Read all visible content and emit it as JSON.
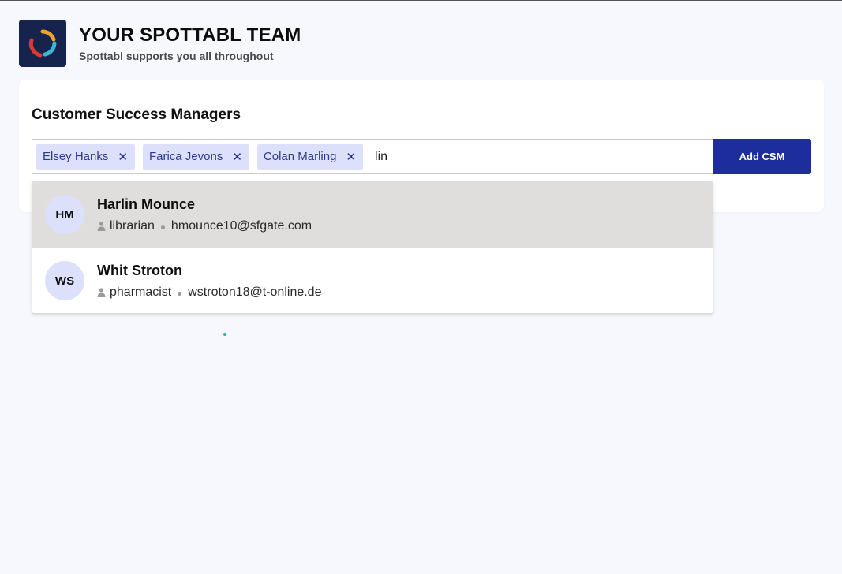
{
  "header": {
    "title": "YOUR SPOTTABL TEAM",
    "subtitle": "Spottabl supports you all throughout",
    "logo_icon": "spottabl-ring-logo"
  },
  "csm": {
    "section_title": "Customer Success Managers",
    "chips": [
      {
        "label": "Elsey Hanks"
      },
      {
        "label": "Farica Jevons"
      },
      {
        "label": "Colan Marling"
      }
    ],
    "input_value": "lin",
    "add_button_label": "Add CSM"
  },
  "suggestions": [
    {
      "initials": "HM",
      "name": "Harlin Mounce",
      "role": "librarian",
      "email": "hmounce10@sfgate.com",
      "highlighted": true
    },
    {
      "initials": "WS",
      "name": "Whit Stroton",
      "role": "pharmacist",
      "email": "wstroton18@t-online.de",
      "highlighted": false
    }
  ],
  "colors": {
    "accent": "#1d2d9c",
    "chip_bg": "#dde0fb",
    "highlight_bg": "#dfdedd",
    "page_bg": "#f7f8fd"
  }
}
